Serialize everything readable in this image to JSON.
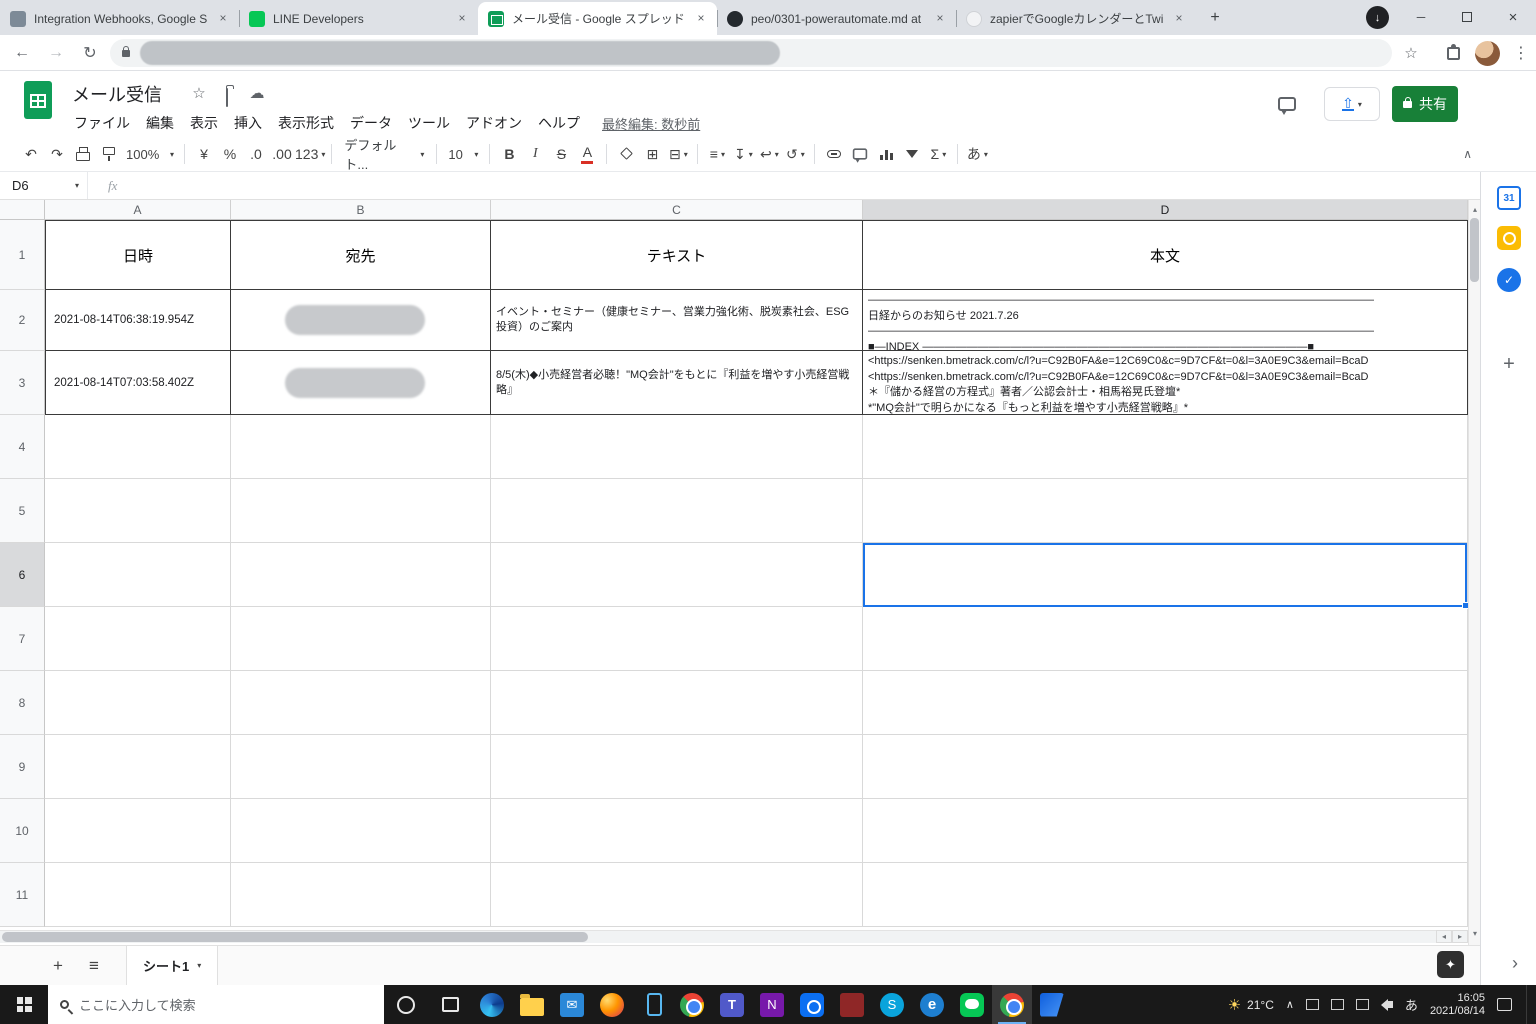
{
  "browser": {
    "tabs": [
      {
        "title": "Integration Webhooks, Google S"
      },
      {
        "title": "LINE Developers"
      },
      {
        "title": "メール受信 - Google スプレッドシート"
      },
      {
        "title": "peo/0301-powerautomate.md at"
      },
      {
        "title": "zapierでGoogleカレンダーとTwilioを"
      }
    ]
  },
  "sheets": {
    "doc_title": "メール受信",
    "menu": [
      "ファイル",
      "編集",
      "表示",
      "挿入",
      "表示形式",
      "データ",
      "ツール",
      "アドオン",
      "ヘルプ"
    ],
    "last_edit": "最終編集: 数秒前",
    "share_label": "共有",
    "toolbar": {
      "zoom": "100%",
      "currency": "¥",
      "percent": "%",
      "dec_dec": ".0",
      "dec_inc": ".00",
      "num_fmt": "123",
      "font_name": "デフォルト...",
      "font_size": "10",
      "bold": "B",
      "italic": "I",
      "strikethrough": "S",
      "text_color": "A",
      "input_tools": "あ"
    },
    "formula_bar": {
      "name_box": "D6",
      "fx": "fx"
    }
  },
  "grid": {
    "col_headers": [
      "A",
      "B",
      "C",
      "D"
    ],
    "row_headers": [
      "1",
      "2",
      "3",
      "4",
      "5",
      "6",
      "7",
      "8",
      "9",
      "10",
      "11"
    ],
    "selected_cell": "D6",
    "cells": {
      "A1": "日時",
      "B1": "宛先",
      "C1": "テキスト",
      "D1": "本文",
      "A2": "2021-08-14T06:38:19.954Z",
      "C2": "イベント・セミナー（健康セミナー、営業力強化術、脱炭素社会、ESG投資）のご案内",
      "D2_lines": [
        "――――――――――――――――――――――――――――――――――――――――――――――",
        "日経からのお知らせ 2021.7.26",
        "――――――――――――――――――――――――――――――――――――――――――――――",
        "■―INDEX ―――――――――――――――――――――――――――――――――――■"
      ],
      "A3": "2021-08-14T07:03:58.402Z",
      "C3": "8/5(木)◆小売経営者必聴！\"MQ会計\"をもとに『利益を増やす小売経営戦略』",
      "D3_lines": [
        "<https://senken.bmetrack.com/c/l?u=C92B0FA&e=12C69C0&c=9D7CF&t=0&l=3A0E9C3&email=BcaD",
        "<https://senken.bmetrack.com/c/l?u=C92B0FA&e=12C69C0&c=9D7CF&t=0&l=3A0E9C3&email=BcaD",
        "＊『儲かる経営の方程式』著者／公認会計士・相馬裕晃氏登壇*",
        "*\"MQ会計\"で明らかになる『もっと利益を増やす小売経営戦略』*"
      ]
    }
  },
  "sheet_bar": {
    "tab_name": "シート1"
  },
  "taskbar": {
    "search_placeholder": "ここに入力して検索",
    "weather_temp": "21°C",
    "ime": "あ",
    "time": "16:05",
    "date": "2021/08/14"
  },
  "colors": {
    "sheets_green": "#0f9d58",
    "share_green": "#188038",
    "selection_blue": "#1a73e8",
    "line_green": "#06c755"
  },
  "icons": {
    "back": "←",
    "forward": "→",
    "reload": "↻",
    "star": "☆",
    "overflow": "⋮",
    "minimize": "─",
    "close": "×",
    "tab_close": "×",
    "new_tab": "+",
    "cloud": "☁",
    "check": "✓",
    "present_arrow": "⇧",
    "caret": "▾",
    "undo": "↶",
    "redo": "↷",
    "borders": "⊞",
    "merge": "⊟",
    "align": "≡",
    "valign": "↧",
    "wrap": "↩",
    "rotate": "↺",
    "sigma": "Σ",
    "collapse": "∧",
    "plus": "+",
    "all_sheets": "≡",
    "explore": "✦",
    "panel_toggle": "›",
    "scroll_left": "◂",
    "scroll_right": "▸",
    "scroll_up": "▴",
    "scroll_down": "▾",
    "sun": "☀",
    "tray_chevron": "∧",
    "envelope": "✉",
    "profile_arrow": "↓",
    "calendar_day": "31",
    "teams_t": "T",
    "onenote_n": "N",
    "skype_s": "S",
    "edge_e": "e"
  }
}
